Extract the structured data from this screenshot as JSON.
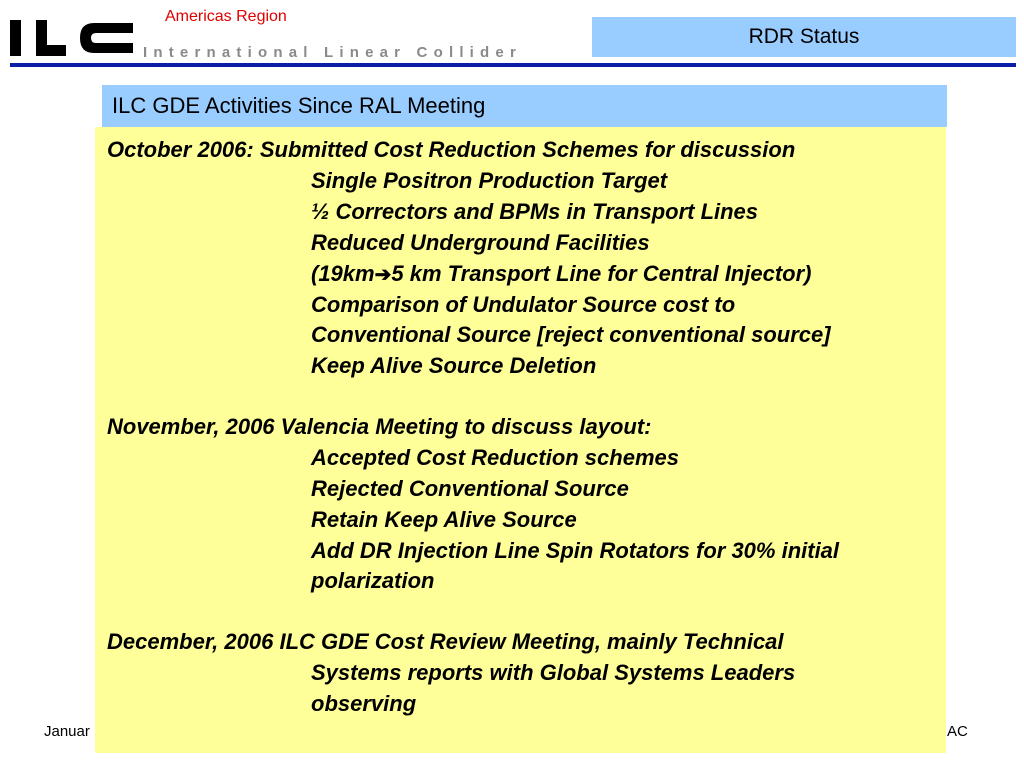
{
  "header": {
    "region": "Americas Region",
    "logo_text": "ILC",
    "logo_subtitle": "International Linear Collider",
    "status": "RDR Status"
  },
  "slide": {
    "title": "ILC GDE Activities Since RAL Meeting",
    "lines": [
      "October 2006: Submitted Cost Reduction Schemes for discussion",
      "Single Positron Production Target",
      "½ Correctors and BPMs in Transport Lines",
      "Reduced Underground Facilities",
      "(19km",
      "➔",
      "5 km Transport Line for Central Injector)",
      "Comparison of Undulator Source cost to",
      "Conventional Source [reject conventional source]",
      "Keep Alive Source Deletion",
      "November, 2006 Valencia Meeting to discuss layout:",
      "Accepted Cost Reduction schemes",
      "Rejected Conventional Source",
      "Retain Keep Alive Source",
      "Add DR Injection Line Spin Rotators for 30% initial",
      "polarization",
      "December, 2006 ILC GDE Cost Review Meeting, mainly Technical",
      "Systems reports with Global Systems Leaders",
      "observing"
    ]
  },
  "footer": {
    "left": "Januar",
    "right": "AC"
  },
  "colors": {
    "header_box": "#99ccff",
    "content_bg": "#ffff99",
    "rule": "#0a1fa8",
    "region_text": "#e00000"
  }
}
